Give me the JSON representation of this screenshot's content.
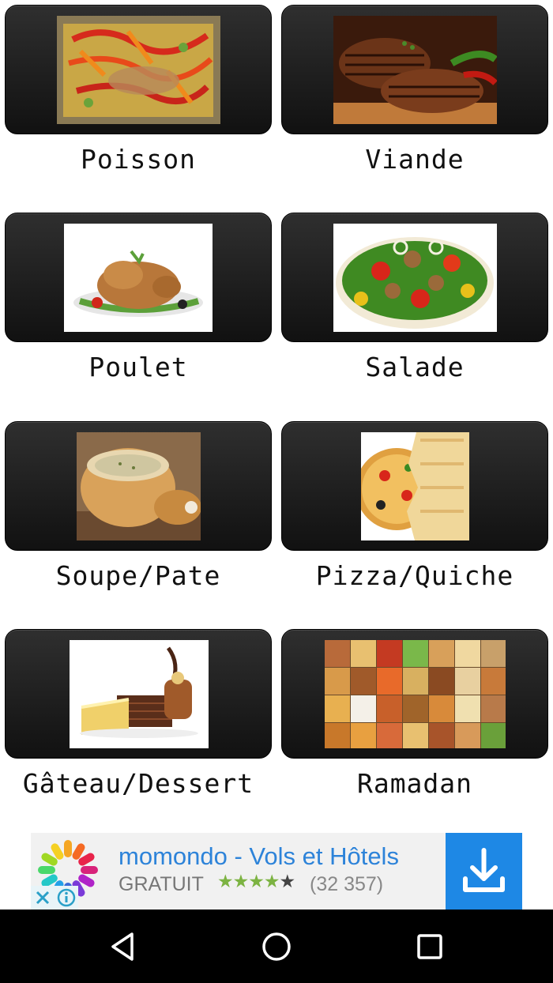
{
  "categories": [
    {
      "label": "Poisson",
      "thumb": "fish-dish-photo"
    },
    {
      "label": "Viande",
      "thumb": "grilled-meat-photo"
    },
    {
      "label": "Poulet",
      "thumb": "roast-chicken-photo"
    },
    {
      "label": "Salade",
      "thumb": "salad-photo"
    },
    {
      "label": "Soupe/Pate",
      "thumb": "bread-bowl-soup-photo"
    },
    {
      "label": "Pizza/Quiche",
      "thumb": "pizza-quiche-photo"
    },
    {
      "label": "Gâteau/Dessert",
      "thumb": "chocolate-cake-photo"
    },
    {
      "label": "Ramadan",
      "thumb": "dish-collage-photo"
    }
  ],
  "ad": {
    "title": "momondo - Vols et Hôtels",
    "price": "GRATUIT",
    "stars": "★★★★",
    "star_last": "★",
    "rating_count": "(32 357)",
    "colors": {
      "title": "#2d83d9",
      "download_bg": "#1e88e5",
      "stars": "#7cb342"
    }
  },
  "navbar": {
    "back_icon": "back-triangle-icon",
    "home_icon": "home-circle-icon",
    "recents_icon": "recents-square-icon"
  }
}
